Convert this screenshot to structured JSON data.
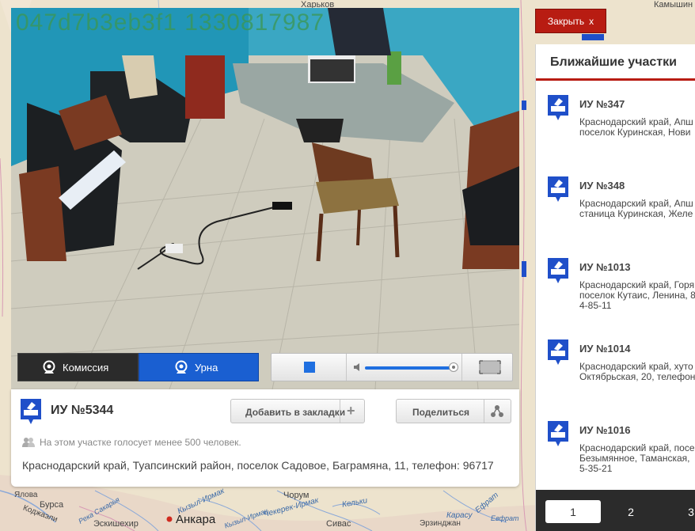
{
  "video": {
    "camera_id": "047d7b3eb3f1 1330817987",
    "tabs": [
      {
        "label": "Комиссия",
        "active": false
      },
      {
        "label": "Урна",
        "active": true
      }
    ],
    "volume_fraction": 0.93
  },
  "station_card": {
    "title": "ИУ №5344",
    "bookmark_label": "Добавить в закладки",
    "share_label": "Поделиться",
    "voters_note": "На этом участке голосует менее 500 человек.",
    "address": "Краснодарский край, Туапсинский район, поселок Садовое, Баграмяна, 11, телефон: 96717"
  },
  "close_button": {
    "label": "Закрыть",
    "icon": "x"
  },
  "nearby": {
    "title": "Ближайшие участки",
    "stations": [
      {
        "title": "ИУ №347",
        "address": "Краснодарский край, Апш\nпоселок Куринская, Нови"
      },
      {
        "title": "ИУ №348",
        "address": "Краснодарский край, Апш\nстаница Куринская, Желе"
      },
      {
        "title": "ИУ №1013",
        "address": "Краснодарский край, Горя\nпоселок Кутаис, Ленина, 8\n4-85-11"
      },
      {
        "title": "ИУ №1014",
        "address": "Краснодарский край, хуто\nОктябрьская, 20, телефон"
      },
      {
        "title": "ИУ №1016",
        "address": "Краснодарский край, посе\nБезымянное, Таманская, \n5-35-21"
      }
    ],
    "pages": [
      "1",
      "2",
      "3"
    ],
    "active_page": "1"
  },
  "map": {
    "labels": [
      "Харьков",
      "Камышин",
      "Бурса",
      "Коджаэли",
      "Эскишехир",
      "Анкара",
      "Кызыл-Ирмак",
      "Чорум",
      "Чекерек-Ирмак",
      "Сивас",
      "Эрзинджан",
      "Кельки",
      "Карасу",
      "Ефрат",
      "Река Сакарья",
      "Кызыл-Ирмак",
      "Евфрат",
      "Ялова"
    ]
  },
  "colors": {
    "accent_red": "#b81c12",
    "accent_blue": "#1a5fd1",
    "map_land": "#eee4cf"
  }
}
